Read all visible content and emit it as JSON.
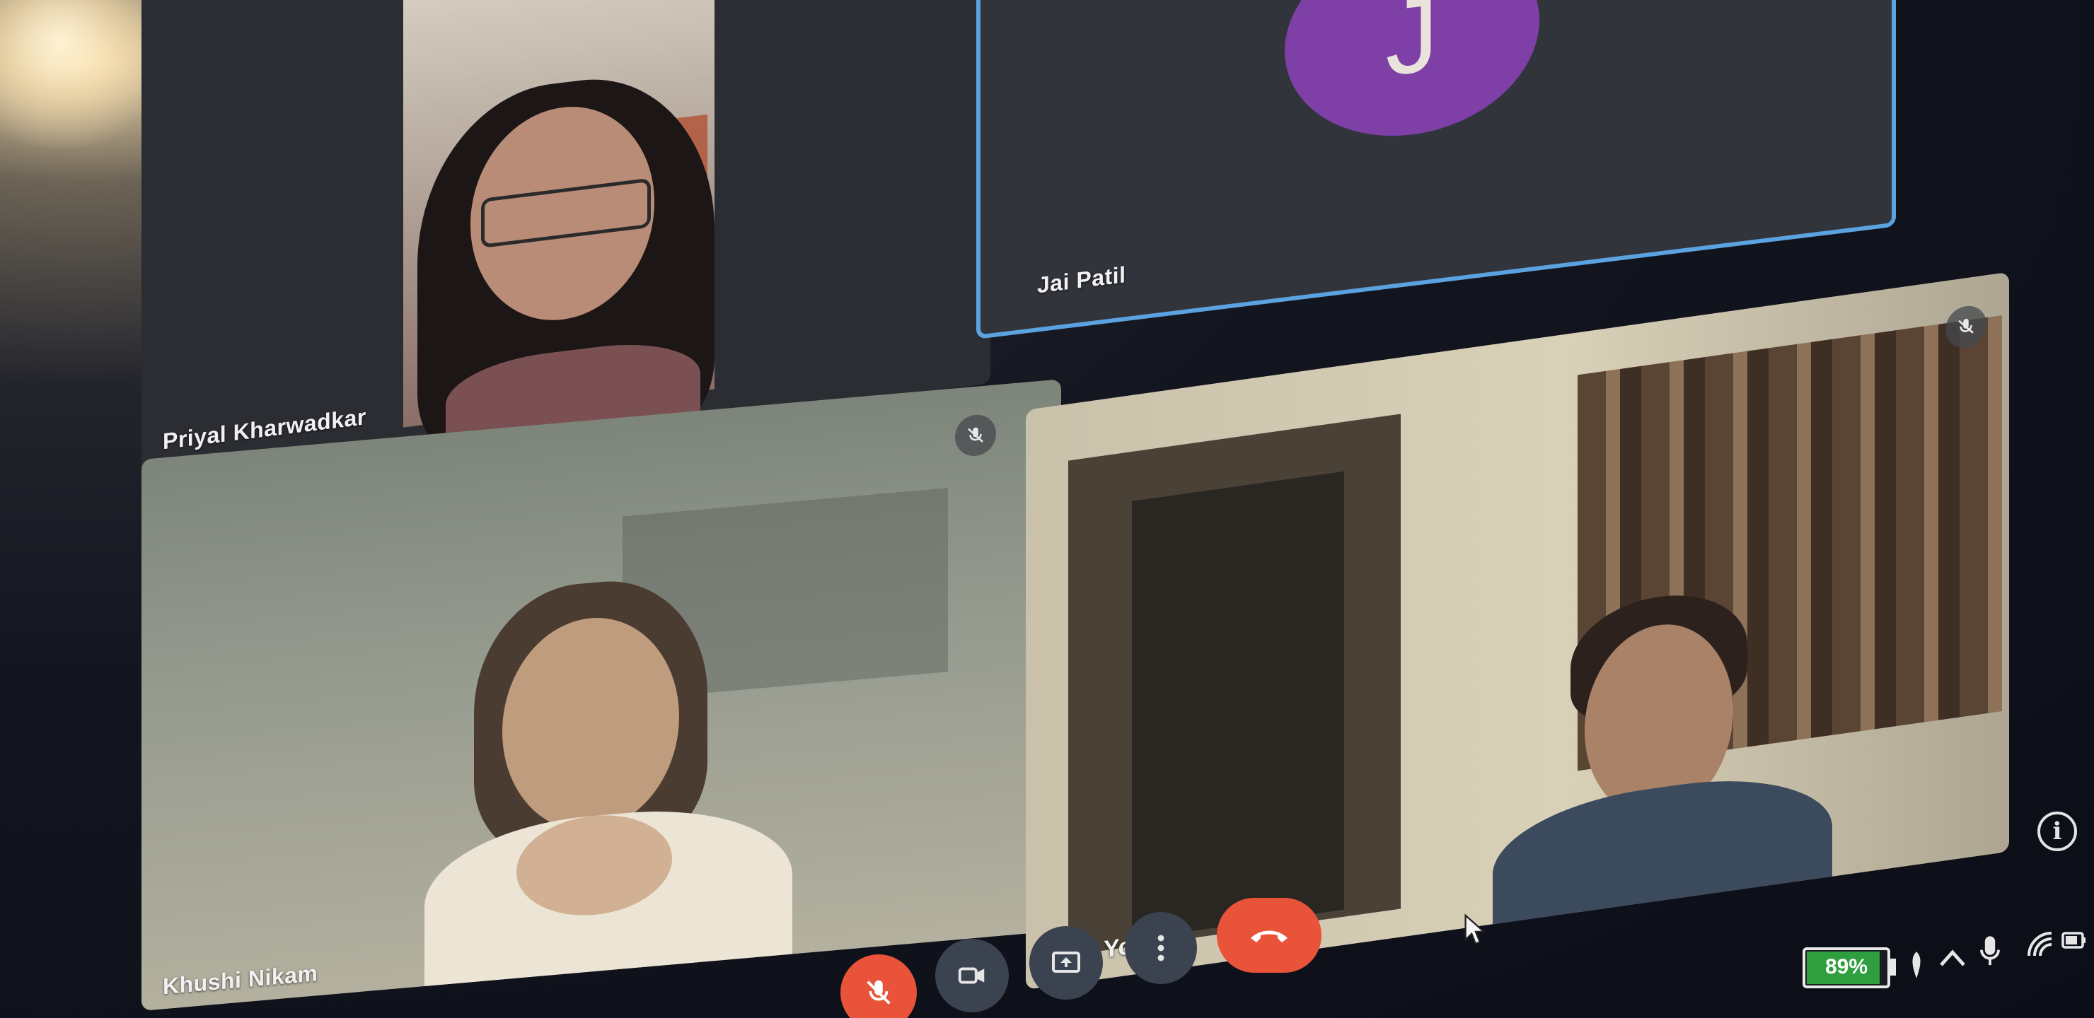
{
  "participants": [
    {
      "name": "Priyal Kharwadkar",
      "muted": false
    },
    {
      "name": "Jai Patil",
      "initial": "J",
      "avatar_color": "#7e3fa6",
      "muted": true,
      "active_speaker_border": "#5aa2e0"
    },
    {
      "name": "Khushi Nikam",
      "muted": true
    },
    {
      "name": "You",
      "muted": false
    }
  ],
  "controls": [
    {
      "icon": "mic-off-icon",
      "color": "#e8533a",
      "state": "muted"
    },
    {
      "icon": "camera-icon",
      "color": "#3b4350"
    },
    {
      "icon": "present-screen-icon",
      "color": "#3b4350"
    },
    {
      "icon": "more-options-icon",
      "color": "#3b4350"
    },
    {
      "icon": "end-call-icon",
      "color": "#e8533a"
    }
  ],
  "system_tray": {
    "battery_percent": "89%",
    "battery_level": 0.89,
    "battery_color": "#2e9e3e",
    "icons": [
      "location-icon",
      "chevron-up-icon",
      "microphone-icon",
      "wifi-icon",
      "battery-saver-icon"
    ]
  },
  "info_icon": "info-icon"
}
